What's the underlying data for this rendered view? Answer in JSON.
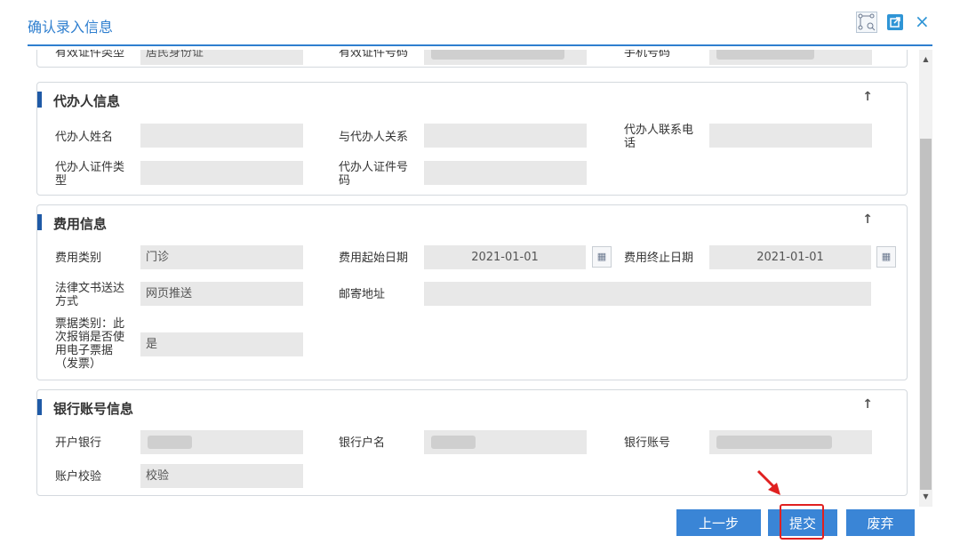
{
  "dialog": {
    "title": "确认录入信息"
  },
  "applicant_row": {
    "id_type_label": "有效证件类型",
    "id_type_value": "居民身份证",
    "id_number_label": "有效证件号码",
    "phone_label": "手机号码"
  },
  "agent": {
    "title": "代办人信息",
    "name_label": "代办人姓名",
    "relation_label": "与代办人关系",
    "phone_label": "代办人联系电话",
    "id_type_label": "代办人证件类型",
    "id_number_label": "代办人证件号码"
  },
  "expense": {
    "title": "费用信息",
    "category_label": "费用类别",
    "category_value": "门诊",
    "start_label": "费用起始日期",
    "start_value": "2021-01-01",
    "end_label": "费用终止日期",
    "end_value": "2021-01-01",
    "delivery_label": "法律文书送达方式",
    "delivery_value": "网页推送",
    "mail_label": "邮寄地址",
    "invoice_label": "票据类别：此次报销是否使用电子票据（发票）",
    "invoice_value": "是"
  },
  "bank": {
    "title": "银行账号信息",
    "bank_label": "开户银行",
    "holder_label": "银行户名",
    "account_label": "银行账号",
    "verify_label": "账户校验",
    "verify_value": "校验"
  },
  "buttons": {
    "prev": "上一步",
    "submit": "提交",
    "discard": "废弃"
  },
  "icons": {
    "collapse": "↑",
    "close": "×",
    "scroll_up": "▲",
    "scroll_down": "▼"
  },
  "colors": {
    "accent": "#2f7fcf",
    "button": "#3a85d6",
    "highlight": "#e02020"
  }
}
